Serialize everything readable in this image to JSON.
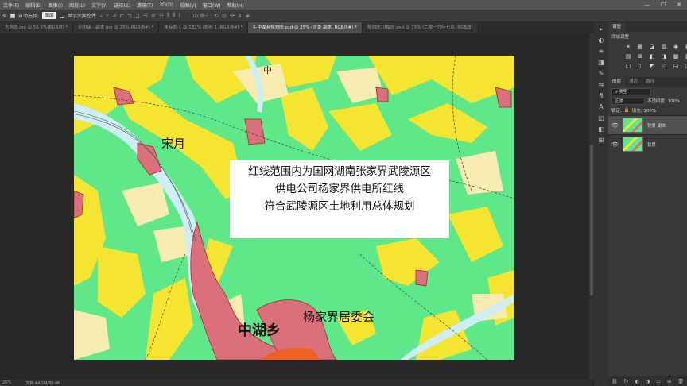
{
  "menu": [
    "文件(F)",
    "编辑(E)",
    "图像(I)",
    "图层(L)",
    "文字(Y)",
    "选择(S)",
    "滤镜(T)",
    "3D(D)",
    "视图(V)",
    "窗口(W)",
    "帮助(H)"
  ],
  "window_controls": [
    "—",
    "☐",
    "✕"
  ],
  "options": {
    "auto_select_label": "自动选择:",
    "auto_select_value": "图层",
    "transform_label": "显示变换控件",
    "mode_label": "3D 模式:"
  },
  "tabs": [
    {
      "label": "大桐图.jpg @ 56.5%(RGB/8) *",
      "active": false
    },
    {
      "label": "初中级 - 副本.jpg @ 25%(RGB/8#) *",
      "active": false
    },
    {
      "label": "未标题-1 @ 132% (矩形 1, RGB/8#) *",
      "active": false
    },
    {
      "label": "6-中湖乡规划图.psd @ 25% (背景 副本, RGB/8#) *",
      "active": true
    },
    {
      "label": "规划图10幅图.psd @ 25% (二零一九年七月, RGB/8)",
      "active": false
    }
  ],
  "document": {
    "note_lines": [
      "红线范围内为国网湖南张家界武陵源区",
      "供电公司杨家界供电所红线",
      "符合武陵源区土地利用总体规划"
    ],
    "labels": {
      "zhong": "中",
      "songyue": "宋月",
      "zhonghuxiang": "中湖乡",
      "yangjiajie": "杨家界居委会"
    },
    "colors": {
      "green": "#5ee88a",
      "yellow": "#f5e430",
      "cream": "#f7ebb0",
      "pink": "#d9707c",
      "water": "#cdeef4"
    }
  },
  "status": {
    "zoom": "25%",
    "doc_info": "文档:44.2M/88.4M"
  },
  "panels": {
    "adjust_tab": "调整",
    "add_adjust_label": "添加调整",
    "adj_icons": [
      "☀",
      "▦",
      "◪",
      "▨",
      "◉",
      "▣",
      "▤",
      "⊠",
      "◧",
      "◨",
      "▩",
      "▥",
      "▢",
      "◫",
      "◩",
      "◰",
      "◱",
      "◲"
    ],
    "layer_tabs": [
      "图层",
      "通道",
      "路径"
    ],
    "kind_label": "ρ 类型",
    "blend_mode": "正常",
    "opacity_label": "不透明度: 100%",
    "lock_label": "锁定:",
    "fill_label": "填充: 100%",
    "layers": [
      {
        "name": "背景 副本",
        "active": true
      },
      {
        "name": "背景",
        "active": false
      }
    ],
    "foot_icons": [
      "⛓",
      "fx",
      "◐",
      "◑",
      "▭",
      "⊞",
      "🗑"
    ]
  },
  "iconstrip": [
    "▸",
    "◐",
    "≡",
    "◨",
    "✎",
    "⇋",
    "¶",
    "A",
    "◫",
    "◧",
    "⊞"
  ]
}
